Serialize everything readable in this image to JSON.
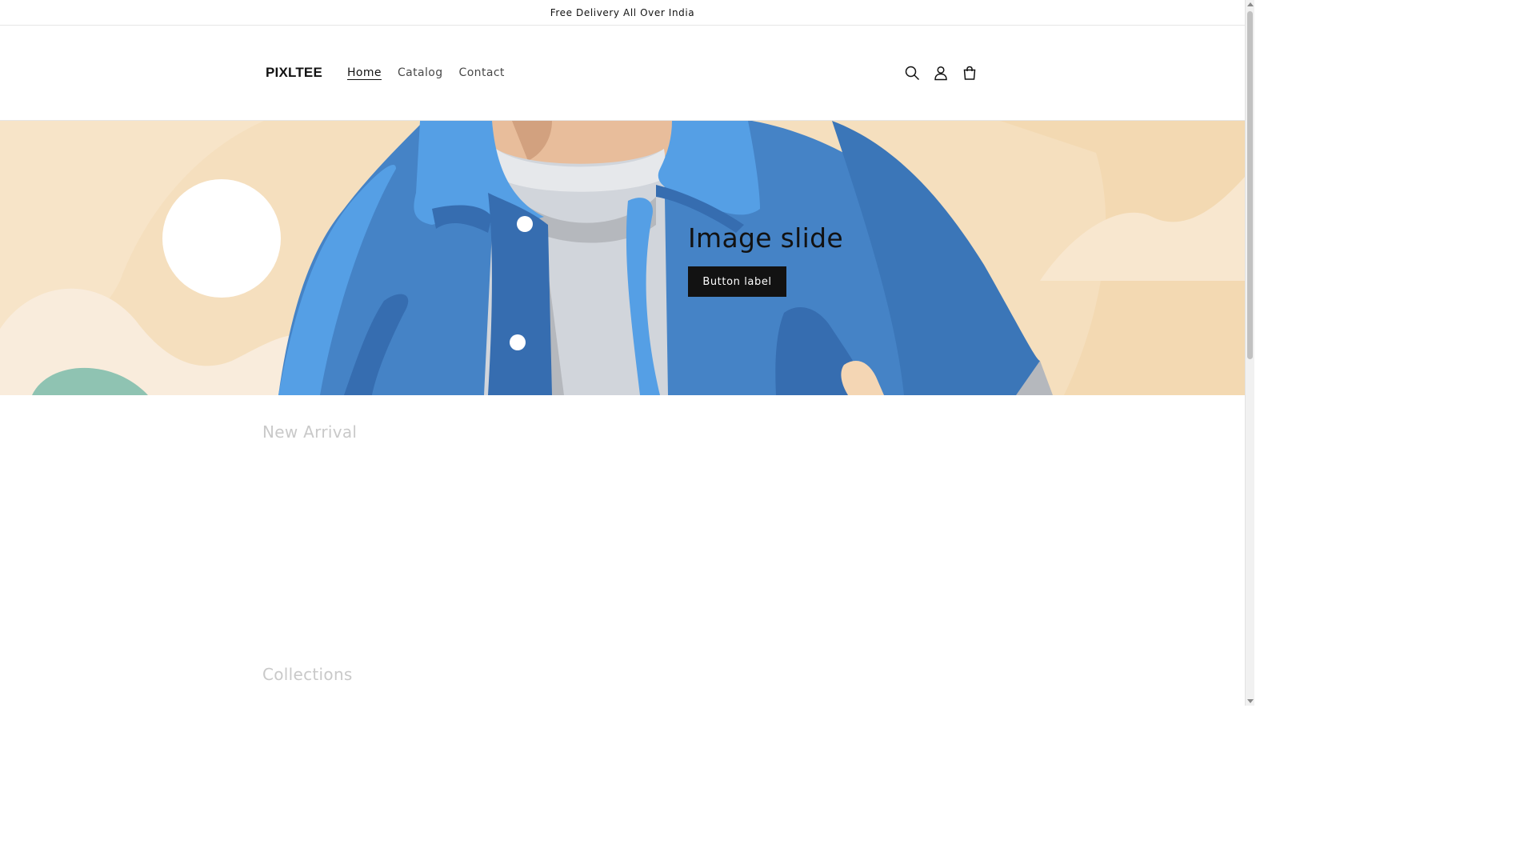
{
  "announcement": {
    "text": "Free Delivery All Over India"
  },
  "header": {
    "logo": "PIXLTEE",
    "nav": [
      {
        "label": "Home",
        "active": true
      },
      {
        "label": "Catalog",
        "active": false
      },
      {
        "label": "Contact",
        "active": false
      }
    ],
    "icons": [
      "search-icon",
      "account-icon",
      "cart-icon"
    ]
  },
  "hero": {
    "title": "Image slide",
    "button_label": "Button label"
  },
  "sections": {
    "new_arrival": "New Arrival",
    "collections": "Collections"
  },
  "colors": {
    "hero_background": "#f5dfbe",
    "jacket_blue": "#4583c6",
    "button_bg": "#121212",
    "section_title": "#c9c9c9"
  }
}
